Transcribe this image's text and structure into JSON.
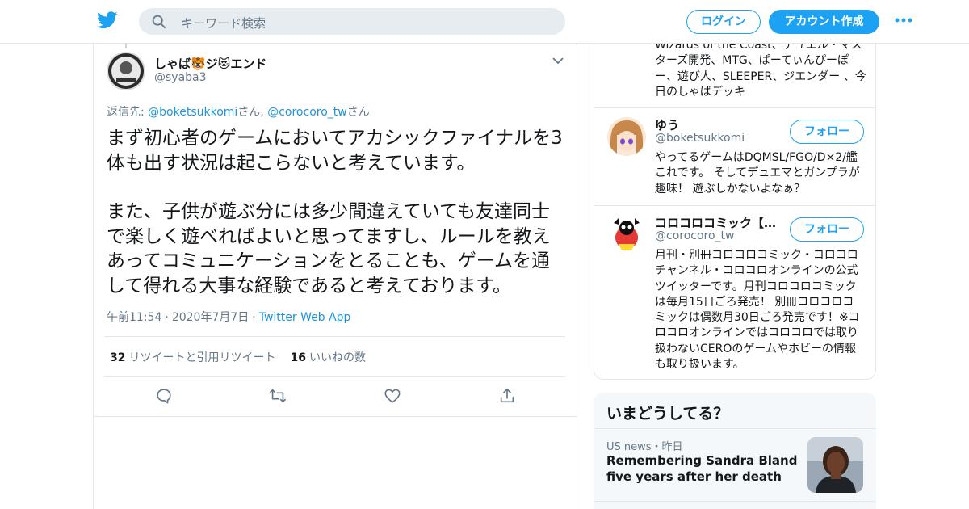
{
  "colors": {
    "accent": "#1da1f2",
    "link": "#1b95e0",
    "muted": "#657786",
    "border": "#e1e8ed"
  },
  "header": {
    "logo_icon": "twitter-bird-icon",
    "search_placeholder": "キーワード検索",
    "login_label": "ログイン",
    "signup_label": "アカウント作成",
    "more_icon": "more-dots-icon"
  },
  "tweet": {
    "author_name": "しゃば🐯ジ😻エンド",
    "author_handle": "@syaba3",
    "reply_prefix": "返信先: ",
    "reply_user1": "@boketsukkomi",
    "reply_san1": "さん, ",
    "reply_user2": "@corocoro_tw",
    "reply_san2": "さん",
    "paragraph1": "まず初心者のゲームにおいてアカシックファイナルを3体も出す状況は起こらないと考えています。",
    "paragraph2": "また、子供が遊ぶ分には多少間違えていても友達同士で楽しく遊べればよいと思ってますし、ルールを教えあってコミュニケーションをとることも、ゲームを通して得れる大事な経験であると考えております。",
    "time": "午前11:54",
    "date": "2020年7月7日",
    "source": "Twitter Web App",
    "retweet_count": "32",
    "retweet_label": "リツイートと引用リツイート",
    "like_count": "16",
    "like_label": "いいねの数",
    "actions": [
      "reply-icon",
      "retweet-icon",
      "like-icon",
      "share-icon"
    ]
  },
  "sidebar": {
    "top_user_desc": "Wizards of the Coast、デュエル・マスターズ開発、MTG、ぱーてぃんぴーぽー、遊び人、SLEEPER、ジエンダー 、今日のしゃばデッキ",
    "users": [
      {
        "name": "ゆう",
        "handle": "@boketsukkomi",
        "follow_label": "フォロー",
        "desc": "やってるゲームはDQMSL/FGO/D×2/艦これです。 そしてデュエマとガンプラが趣味！ 遊ぶしかないよなぁ？"
      },
      {
        "name": "コロコロコミック【…",
        "handle": "@corocoro_tw",
        "follow_label": "フォロー",
        "desc": "月刊・別冊コロコロコミック・コロコロチャンネル・コロコロオンラインの公式ツイッターです。月刊コロコロコミックは毎月15日ごろ発売！ 別冊コロコロコミックは偶数月30日ごろ発売です！※コロコロオンラインではコロコロでは取り扱わないCEROのゲームやホビーの情報も取り扱います。"
      }
    ]
  },
  "trends": {
    "title": "いまどうしてる？",
    "items": [
      {
        "meta": "US news・昨日",
        "headline": "Remembering Sandra Bland five years after her death"
      }
    ]
  }
}
